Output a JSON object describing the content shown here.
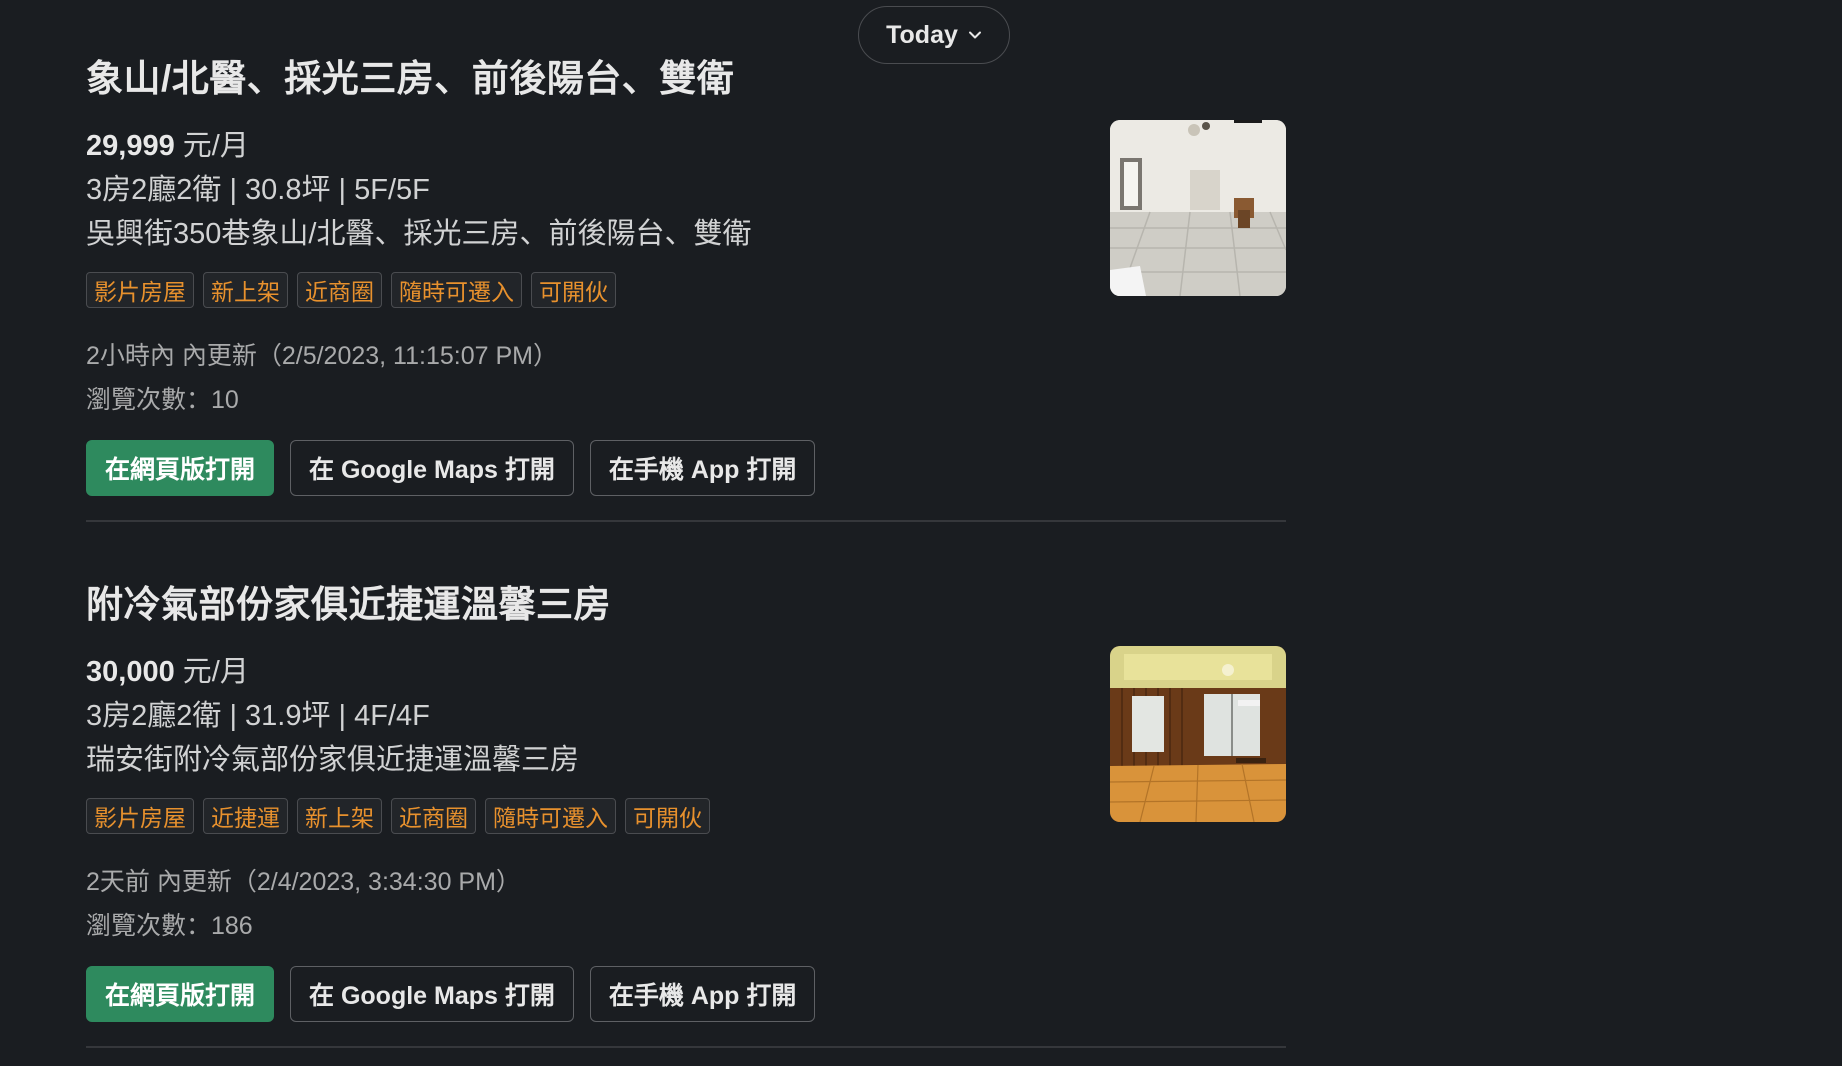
{
  "date_divider": {
    "label": "Today"
  },
  "listings": [
    {
      "title": "象山/北醫、採光三房、前後陽台、雙衛",
      "price": "29,999",
      "price_unit": "元/月",
      "specs": "3房2廳2衛 | 30.8坪 | 5F/5F",
      "address": "吳興街350巷象山/北醫、採光三房、前後陽台、雙衛",
      "tags": [
        "影片房屋",
        "新上架",
        "近商圈",
        "隨時可遷入",
        "可開伙"
      ],
      "updated": "2小時內 內更新（2/5/2023, 11:15:07 PM）",
      "views": "瀏覽次數：10",
      "buttons": {
        "web": "在網頁版打開",
        "maps": "在 Google Maps 打開",
        "app": "在手機 App 打開"
      }
    },
    {
      "title": "附冷氣部份家俱近捷運溫馨三房",
      "price": "30,000",
      "price_unit": "元/月",
      "specs": "3房2廳2衛 | 31.9坪 | 4F/4F",
      "address": "瑞安街附冷氣部份家俱近捷運溫馨三房",
      "tags": [
        "影片房屋",
        "近捷運",
        "新上架",
        "近商圈",
        "隨時可遷入",
        "可開伙"
      ],
      "updated": "2天前 內更新（2/4/2023, 3:34:30 PM）",
      "views": "瀏覽次數：186",
      "buttons": {
        "web": "在網頁版打開",
        "maps": "在 Google Maps 打開",
        "app": "在手機 App 打開"
      }
    }
  ],
  "colors": {
    "background": "#1a1d21",
    "primary_button": "#2e8a5e",
    "tag_text": "#e8912d"
  },
  "icons": {
    "date_pill": "chevron-down-icon"
  }
}
